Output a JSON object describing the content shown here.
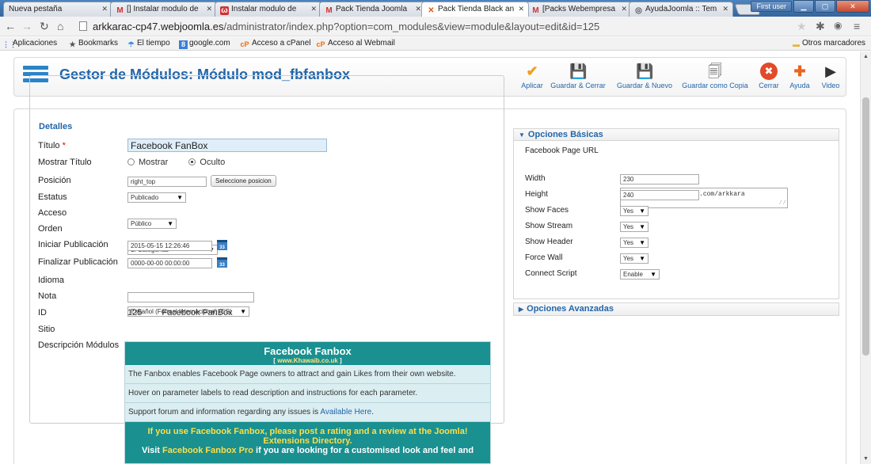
{
  "browser": {
    "tabs": [
      {
        "label": "Nueva pestaña",
        "icon": ""
      },
      {
        "label": "[] Instalar modulo de",
        "icon": "M"
      },
      {
        "label": "Instalar modulo de",
        "icon": "ω"
      },
      {
        "label": "Pack Tienda Joomla",
        "icon": "M"
      },
      {
        "label": "Pack Tienda Black an",
        "icon": "✕"
      },
      {
        "label": "[Packs Webempresa",
        "icon": "M"
      },
      {
        "label": "AyudaJoomla :: Tem",
        "icon": "◎"
      }
    ],
    "user_badge": "First user",
    "url_host": "arkkarac-cp47.webjoomla.es",
    "url_path": "/administrator/index.php?option=com_modules&view=module&layout=edit&id=125",
    "bookmarks": [
      {
        "label": "Aplicaciones",
        "icon": "⋮⋮"
      },
      {
        "label": "Bookmarks",
        "icon": "★"
      },
      {
        "label": "El tiempo",
        "icon": "☂"
      },
      {
        "label": "google.com",
        "icon": "8"
      },
      {
        "label": "Acceso a cPanel",
        "icon": "cP"
      },
      {
        "label": "Acceso al Webmail",
        "icon": "cP"
      }
    ],
    "other_bookmarks": "Otros marcadores"
  },
  "header": {
    "title": "Gestor de Módulos: Módulo mod_fbfanbox",
    "buttons": [
      {
        "label": "Aplicar",
        "icon": "✔"
      },
      {
        "label": "Guardar & Cerrar",
        "icon": "💾"
      },
      {
        "label": "Guardar & Nuevo",
        "icon": "💾"
      },
      {
        "label": "Guardar como Copia",
        "icon": "🗐"
      },
      {
        "label": "Cerrar",
        "icon": "✖"
      },
      {
        "label": "Ayuda",
        "icon": "✚"
      },
      {
        "label": "Video",
        "icon": "▶"
      }
    ]
  },
  "details": {
    "legend": "Detalles",
    "title_label": "Título",
    "required_mark": "*",
    "title_value": "Facebook FanBox",
    "show_title_label": "Mostrar Título",
    "show_option": "Mostrar",
    "hide_option": "Oculto",
    "position_label": "Posición",
    "position_value": "right_top",
    "position_button": "Seleccione posicion",
    "status_label": "Estatus",
    "status_value": "Publicado",
    "access_label": "Acceso",
    "access_value": "Público",
    "order_label": "Orden",
    "order_value": "1. Categorías",
    "start_label": "Iniciar Publicación",
    "start_value": "2015-05-15 12:26:46",
    "end_label": "Finalizar Publicación",
    "end_value": "0000-00-00 00:00:00",
    "language_label": "Idioma",
    "language_value": "Español (Formal Internacional) (ES)",
    "note_label": "Nota",
    "note_value": "",
    "id_label": "ID",
    "id_value": "125",
    "id_name": "Facebook FanBox",
    "site_label": "Sitio",
    "desc_label": "Descripción Módulos",
    "calendar_icon": "33"
  },
  "description": {
    "heading": "Facebook Fanbox",
    "site": "www.Khawaib.co.uk",
    "p1": "The Fanbox enables Facebook Page owners to attract and gain Likes from their own website.",
    "p2": "Hover on parameter labels to read description and instructions for each parameter.",
    "p3_text": "Support forum and information regarding any issues is ",
    "p3_link": "Available Here",
    "p3_end": ".",
    "footer1": "If you use Facebook Fanbox, please post a rating and a review at the Joomla!",
    "footer2": "Extensions Directory.",
    "footer3_a": "Visit ",
    "footer3_link": "Facebook Fanbox Pro",
    "footer3_b": " if you are looking for a customised look and feel and"
  },
  "basic_options": {
    "title": "Opciones Básicas",
    "page_url_label": "Facebook Page URL",
    "page_url_value": "https://www.facebook.com/arkkara",
    "width_label": "Width",
    "width_value": "230",
    "height_label": "Height",
    "height_value": "240",
    "faces_label": "Show Faces",
    "faces_value": "Yes",
    "stream_label": "Show Stream",
    "stream_value": "Yes",
    "header_label": "Show Header",
    "header_value": "Yes",
    "wall_label": "Force Wall",
    "wall_value": "Yes",
    "script_label": "Connect Script",
    "script_value": "Enable"
  },
  "advanced_options": {
    "title": "Opciones Avanzadas"
  }
}
